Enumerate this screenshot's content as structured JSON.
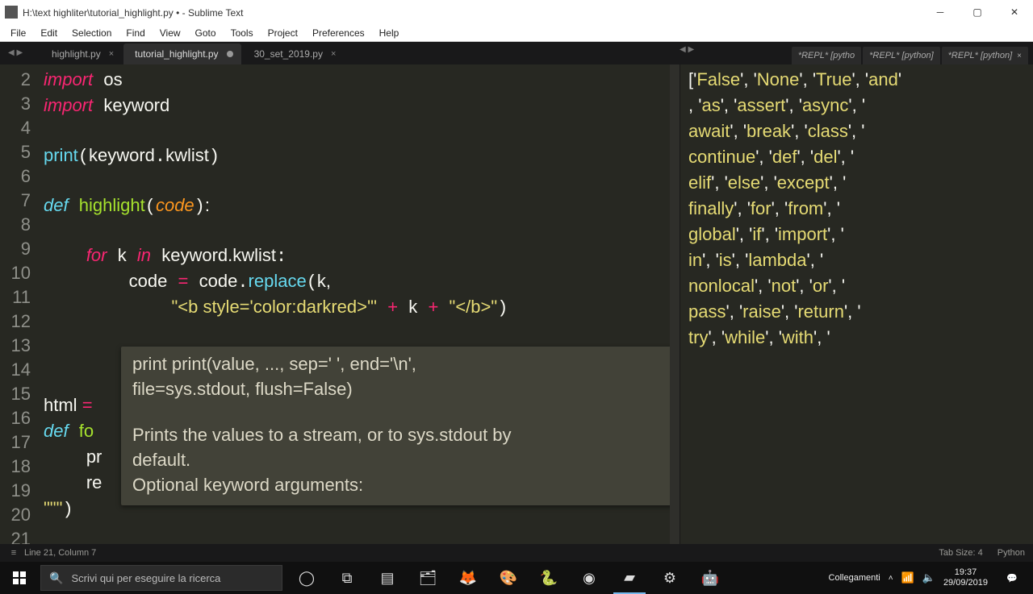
{
  "window": {
    "title": "H:\\text highliter\\tutorial_highlight.py • - Sublime Text"
  },
  "menu": {
    "file": "File",
    "edit": "Edit",
    "selection": "Selection",
    "find": "Find",
    "view": "View",
    "goto": "Goto",
    "tools": "Tools",
    "project": "Project",
    "preferences": "Preferences",
    "help": "Help"
  },
  "tabs": {
    "t0": "highlight.py",
    "t1": "tutorial_highlight.py",
    "t2": "30_set_2019.py",
    "r0": "*REPL* [pytho",
    "r1": "*REPL* [python]",
    "r2": "*REPL* [python]"
  },
  "gutter": {
    "l2": "2",
    "l3": "3",
    "l4": "4",
    "l5": "5",
    "l6": "6",
    "l7": "7",
    "l8": "8",
    "l9": "9",
    "l10": "10",
    "l11": "11",
    "l12": "12",
    "l13": "13",
    "l14": "14",
    "l15": "15",
    "l16": "16",
    "l17": "17",
    "l18": "18",
    "l19": "19",
    "l20": "20",
    "l21": "21"
  },
  "code": {
    "import": "import",
    "os": "os",
    "keyword": "keyword",
    "print": "print",
    "kparen_open": "(",
    "kwmod": "keyword",
    ".": ".",
    "kwlist": "kwlist",
    ")": ")",
    "def": "def",
    "highlight": "highlight",
    "codeparam": "code",
    "colon": ":",
    "for": "for",
    "k": "k",
    "in": "in",
    "kwlist2": "keyword.kwlist",
    "code_eq": "code ",
    "eq": "=",
    "code2": " code",
    "dot": ".",
    "replace": "replace",
    "kc": "k",
    ",": ",",
    "str1": "\"<b style='color:darkred>'\"",
    "plus": "+",
    "k2": "k",
    "str2": "\"</b>\"",
    ")2": ")",
    "html": "html ",
    "triple": "",
    "deffo": "def",
    "fo": "fo",
    "pr": "pr",
    "re": "re",
    "tq": "\"\"\"",
    "printcall": "print",
    "paren": "()"
  },
  "tooltip": {
    "sig": "print print(value, ..., sep=' ', end='\\n',\nfile=sys.stdout, flush=False)",
    "desc": "Prints the values to a stream, or to sys.stdout by\ndefault.\nOptional keyword arguments:"
  },
  "repl_output": "['False', 'None', 'True', 'and'\n, 'as', 'assert', 'async', '\nawait', 'break', 'class', '\ncontinue', 'def', 'del', '\nelif', 'else', 'except', '\nfinally', 'for', 'from', '\nglobal', 'if', 'import', '\nin', 'is', 'lambda', '\nnonlocal', 'not', 'or', '\npass', 'raise', 'return', '\ntry', 'while', 'with', '",
  "status": {
    "pos": "Line 21, Column 7",
    "tabsize": "Tab Size: 4",
    "lang": "Python"
  },
  "taskbar": {
    "search_placeholder": "Scrivi qui per eseguire la ricerca",
    "links": "Collegamenti",
    "time": "19:37",
    "date": "29/09/2019"
  }
}
